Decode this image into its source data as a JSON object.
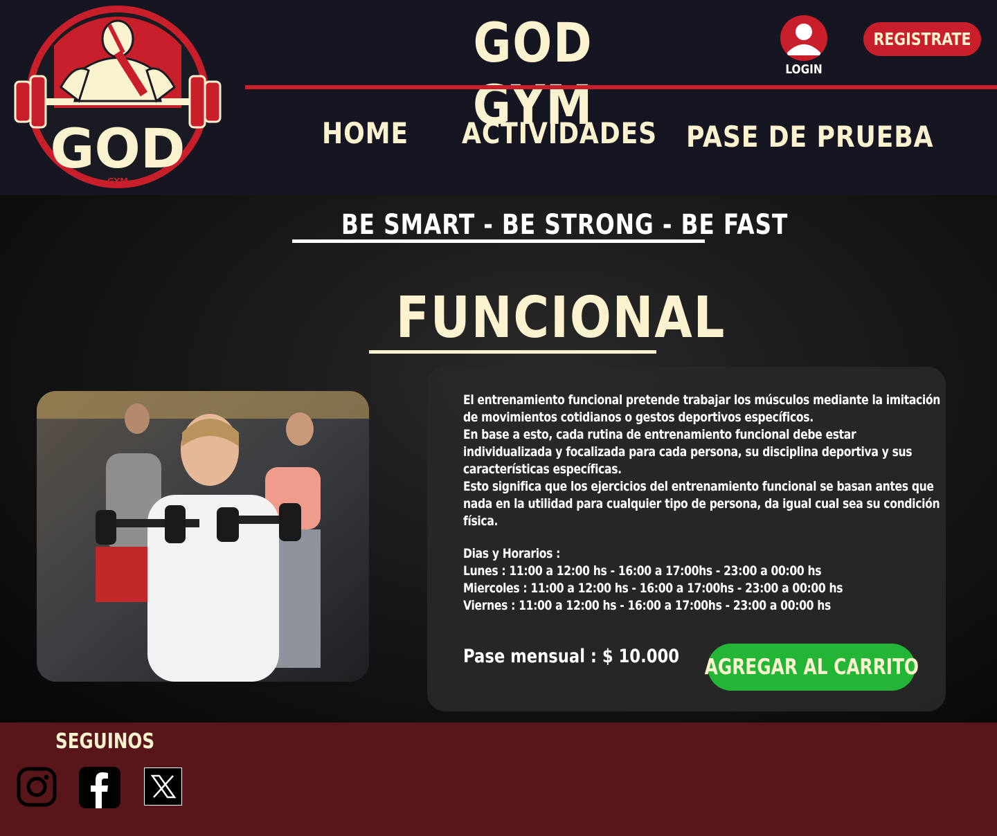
{
  "header": {
    "brand_title": "GOD GYM",
    "logo_text": "GOD",
    "logo_subtext": "GYM",
    "login_label": "LOGIN",
    "register_label": "REGISTRATE"
  },
  "nav": {
    "items": [
      {
        "label": "HOME"
      },
      {
        "label": "ACTIVIDADES"
      },
      {
        "label": "PASE DE PRUEBA"
      }
    ]
  },
  "main": {
    "slogan": "BE SMART - BE STRONG - BE FAST",
    "title": "FUNCIONAL",
    "description": [
      "El entrenamiento funcional pretende trabajar los músculos mediante la imitación de movimientos cotidianos o gestos deportivos específicos.",
      "En base a esto, cada rutina de entrenamiento funcional debe estar individualizada y focalizada para cada persona, su disciplina deportiva y sus características específicas.",
      "Esto significa que los ejercicios del entrenamiento funcional se basan antes que nada en la utilidad para cualquier tipo de persona, da igual cual sea su condición física."
    ],
    "schedule": {
      "heading": "Dias y Horarios :",
      "lines": [
        "Lunes : 11:00 a 12:00 hs - 16:00 a 17:00hs - 23:00 a 00:00 hs",
        "Miercoles : 11:00 a 12:00 hs - 16:00 a 17:00hs - 23:00 a 00:00 hs",
        "Viernes :  11:00 a 12:00 hs - 16:00 a 17:00hs - 23:00 a 00:00 hs"
      ]
    },
    "price": "Pase mensual : $ 10.000",
    "cart_button": "AGREGAR AL CARRITO"
  },
  "footer": {
    "follow_label": "SEGUINOS",
    "social": [
      {
        "name": "instagram-icon"
      },
      {
        "name": "facebook-icon"
      },
      {
        "name": "x-icon"
      }
    ]
  },
  "colors": {
    "header_bg": "#161622",
    "accent_red": "#c81f2a",
    "cream": "#fbf2cf",
    "cart_green": "#22b536",
    "footer_bg": "#58161a"
  }
}
